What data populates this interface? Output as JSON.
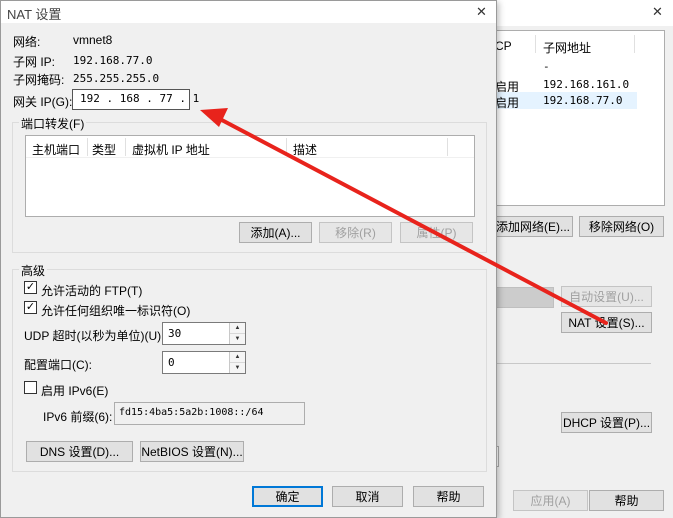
{
  "background_window": {
    "columns": [
      "CP",
      "子网地址"
    ],
    "rows": [
      {
        "dhcp": "",
        "subnet": "-"
      },
      {
        "dhcp": "启用",
        "subnet": "192.168.161.0"
      },
      {
        "dhcp": "启用",
        "subnet": "192.168.77.0"
      }
    ],
    "add_network": "添加网络(E)...",
    "remove_network": "移除网络(O)",
    "auto_settings": "自动设置(U)...",
    "nat_settings": "NAT 设置(S)...",
    "dhcp_settings": "DHCP 设置(P)...",
    "apply": "应用(A)",
    "help": "帮助",
    "close_icon": "✕"
  },
  "dialog": {
    "title": "NAT 设置",
    "close_icon": "✕",
    "network_label": "网络:",
    "network_value": "vmnet8",
    "subnet_ip_label": "子网 IP:",
    "subnet_ip_value": "192.168.77.0",
    "subnet_mask_label": "子网掩码:",
    "subnet_mask_value": "255.255.255.0",
    "gateway_label": "网关 IP(G):",
    "gateway_value": "192 . 168 . 77 . 1",
    "port_forwarding": {
      "title": "端口转发(F)",
      "columns": [
        "主机端口",
        "类型",
        "虚拟机 IP 地址",
        "描述"
      ],
      "add": "添加(A)...",
      "remove": "移除(R)",
      "properties": "属性(P)"
    },
    "advanced": {
      "title": "高级",
      "allow_ftp": "允许活动的 FTP(T)",
      "allow_ftp_checked": true,
      "allow_oui": "允许任何组织唯一标识符(O)",
      "allow_oui_checked": true,
      "udp_timeout_label": "UDP 超时(以秒为单位)(U):",
      "udp_timeout_value": "30",
      "config_port_label": "配置端口(C):",
      "config_port_value": "0",
      "enable_ipv6": "启用 IPv6(E)",
      "enable_ipv6_checked": false,
      "ipv6_prefix_label": "IPv6 前缀(6):",
      "ipv6_prefix_value": "fd15:4ba5:5a2b:1008::/64",
      "dns_settings": "DNS 设置(D)...",
      "netbios_settings": "NetBIOS 设置(N)..."
    },
    "ok": "确定",
    "cancel": "取消",
    "help": "帮助",
    "check_mark": "✓"
  },
  "colors": {
    "arrow": "#e8231c",
    "title_bar": "#ffffff",
    "selected_row": "#e5f3ff"
  }
}
